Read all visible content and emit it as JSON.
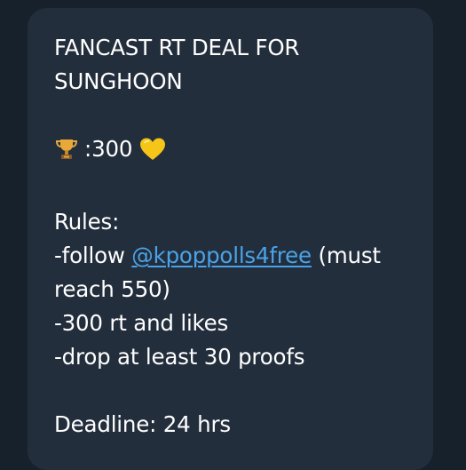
{
  "message": {
    "title": "FANCAST RT DEAL FOR SUNGHOON",
    "title_line1": "FANCAST RT DEAL FOR",
    "title_line2": "SUNGHOON",
    "prize": {
      "icon": "trophy-icon",
      "separator": ":",
      "amount": "300",
      "heart_icon": "yellow-heart-icon",
      "heart_color": "#f5c518"
    },
    "rules_label": "Rules:",
    "rule1_prefix": "-follow",
    "rule1_mention": "@kpoppolls4free",
    "rule1_suffix_a": "(must",
    "rule1_suffix_b": "reach 550)",
    "rule2": "-300 rt and likes",
    "rule3": "-drop at least 30 proofs",
    "deadline": "Deadline: 24 hrs"
  },
  "colors": {
    "background": "#17212b",
    "bubble": "#232e3c",
    "text": "#ffffff",
    "link": "#4aa3e8"
  }
}
